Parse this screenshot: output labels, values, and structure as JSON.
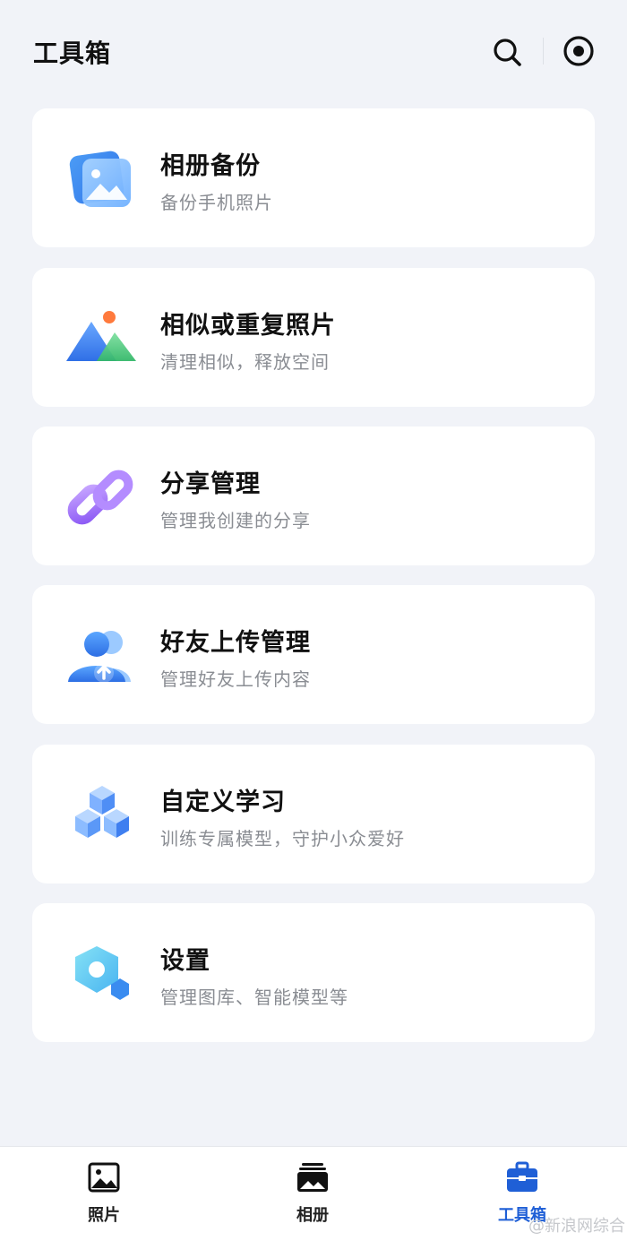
{
  "header": {
    "title": "工具箱"
  },
  "cards": [
    {
      "title": "相册备份",
      "subtitle": "备份手机照片",
      "icon": "album-backup-icon"
    },
    {
      "title": "相似或重复照片",
      "subtitle": "清理相似，释放空间",
      "icon": "mountain-photo-icon"
    },
    {
      "title": "分享管理",
      "subtitle": "管理我创建的分享",
      "icon": "link-icon"
    },
    {
      "title": "好友上传管理",
      "subtitle": "管理好友上传内容",
      "icon": "friends-upload-icon"
    },
    {
      "title": "自定义学习",
      "subtitle": "训练专属模型，守护小众爱好",
      "icon": "cubes-icon"
    },
    {
      "title": "设置",
      "subtitle": "管理图库、智能模型等",
      "icon": "settings-hexagon-icon"
    }
  ],
  "tabbar": {
    "tabs": [
      {
        "label": "照片",
        "icon": "photo-icon",
        "active": false
      },
      {
        "label": "相册",
        "icon": "album-icon",
        "active": false
      },
      {
        "label": "工具箱",
        "icon": "toolbox-icon",
        "active": true
      }
    ]
  },
  "watermark": "@新浪网综合",
  "colors": {
    "background": "#f1f3f8",
    "card": "#ffffff",
    "active_tab": "#1f5fd6",
    "subtitle": "#8a8d93"
  }
}
